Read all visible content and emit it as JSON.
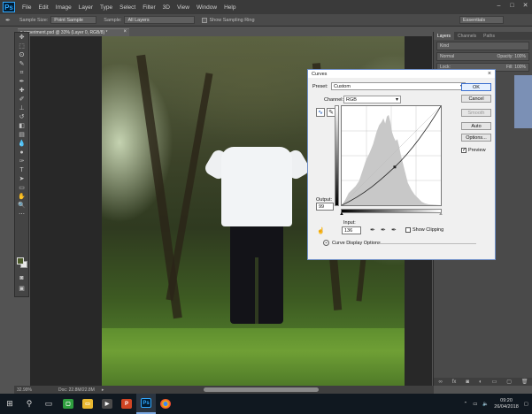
{
  "menu": {
    "logo": "Ps",
    "items": [
      "File",
      "Edit",
      "Image",
      "Layer",
      "Type",
      "Select",
      "Filter",
      "3D",
      "View",
      "Window",
      "Help"
    ]
  },
  "options_bar": {
    "sample_size_label": "Sample Size:",
    "sample_size_value": "Point Sample",
    "sample_label": "Sample:",
    "sample_value": "All Layers",
    "show_ring_label": "Show Sampling Ring",
    "workspace": "Essentials"
  },
  "document": {
    "tab_title": "s experiment.psd @ 33% (Layer 0, RGB/8) *"
  },
  "panels": {
    "tabs": [
      "Layers",
      "Channels",
      "Paths"
    ],
    "kind_label": "Kind",
    "blend_mode": "Normal",
    "opacity_label": "Opacity:",
    "opacity_value": "100%",
    "lock_label": "Lock:",
    "fill_label": "Fill:",
    "fill_value": "100%"
  },
  "status": {
    "zoom": "32.99%",
    "doc_size": "Doc: 22.8M/22.8M"
  },
  "curves": {
    "title": "Curves",
    "preset_label": "Preset:",
    "preset_value": "Custom",
    "channel_label": "Channel:",
    "channel_value": "RGB",
    "output_label": "Output:",
    "output_value": "99",
    "input_label": "Input:",
    "input_value": "136",
    "show_clipping_label": "Show Clipping",
    "curve_display_options_label": "Curve Display Options",
    "buttons": {
      "ok": "OK",
      "cancel": "Cancel",
      "smooth": "Smooth",
      "auto": "Auto",
      "options": "Options..."
    },
    "preview_label": "Preview",
    "preview_checked": true,
    "histogram_color": "#c8c8c8",
    "curve_color": "#222222"
  },
  "taskbar": {
    "time": "09:20",
    "date": "26/04/2018"
  }
}
